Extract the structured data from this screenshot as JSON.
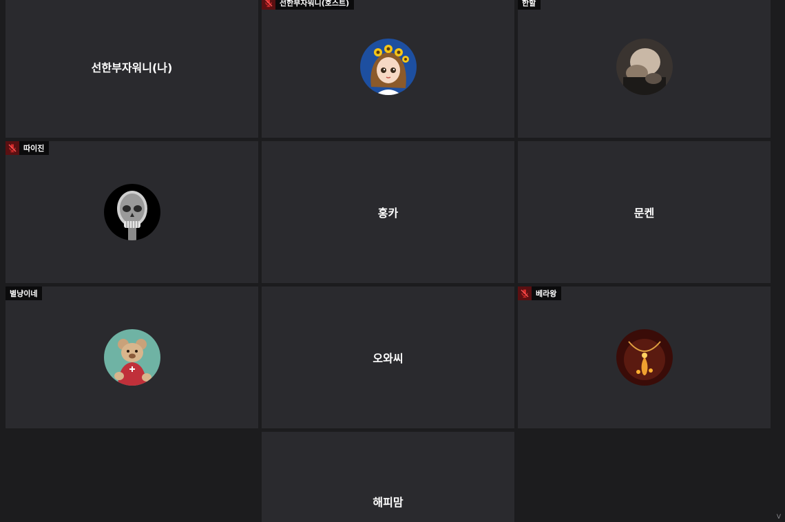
{
  "participants": [
    {
      "id": "self",
      "name": "선한부자워니(나)",
      "tag": "",
      "icon": "none"
    },
    {
      "id": "host",
      "name": "선한부자워니(호스트)",
      "tag": "선한부자워니(호스트)",
      "icon": "muted-mic-icon",
      "avatar": "cartoon-girl-sunflower-avatar"
    },
    {
      "id": "p3",
      "name": "한할",
      "tag": "한할",
      "icon": "none",
      "avatar": "dark-photo-avatar"
    },
    {
      "id": "p4",
      "name": "따이진",
      "tag": "따이진",
      "icon": "muted-mic-icon",
      "avatar": "skull-xray-avatar"
    },
    {
      "id": "p5",
      "name": "홍카",
      "tag": "",
      "icon": "none"
    },
    {
      "id": "p6",
      "name": "문켄",
      "tag": "",
      "icon": "none"
    },
    {
      "id": "p7",
      "name": "별냥이네",
      "tag": "별냥이네",
      "icon": "none",
      "avatar": "teddy-bear-avatar"
    },
    {
      "id": "p8",
      "name": "오와씨",
      "tag": "",
      "icon": "none"
    },
    {
      "id": "p9",
      "name": "베라왕",
      "tag": "베라왕",
      "icon": "muted-mic-icon",
      "avatar": "gold-necklace-avatar"
    },
    {
      "id": "p10",
      "name": "해피맘",
      "tag": "",
      "icon": "none"
    }
  ],
  "colors": {
    "background": "#1c1c1e",
    "tile": "#2a2a2e",
    "badge": "#5a1012",
    "muted_icon": "#d42a2a"
  },
  "corner_mark": "V"
}
